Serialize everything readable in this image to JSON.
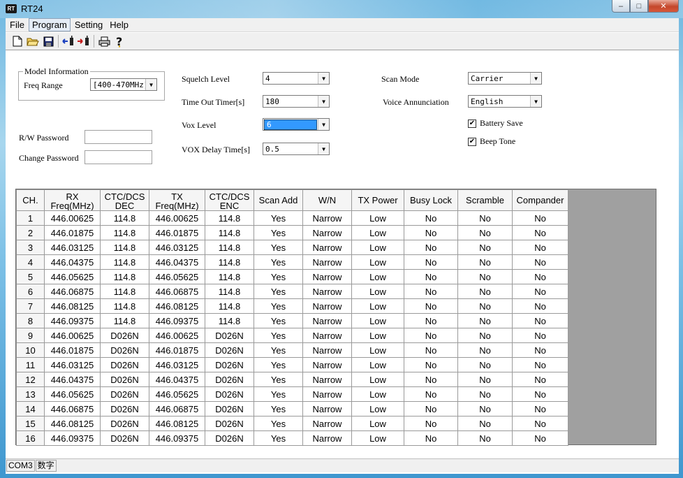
{
  "window": {
    "app_icon_text": "RT",
    "title": "RT24",
    "minimize": "‒",
    "maximize": "□",
    "close": "✕"
  },
  "menu": [
    "File",
    "Program",
    "Setting",
    "Help"
  ],
  "toolbar": [
    "new-file-icon",
    "open-folder-icon",
    "save-icon",
    "read-from-radio-icon",
    "write-to-radio-icon",
    "print-icon",
    "help-icon"
  ],
  "model_info": {
    "group_title": "Model Information",
    "freq_range_label": "Freq Range",
    "freq_range_value": "[400-470MHz]"
  },
  "passwords": {
    "rw_label": "R/W Password",
    "rw_value": "",
    "change_label": "Change Password",
    "change_value": ""
  },
  "settings": {
    "squelch_label": "Squelch Level",
    "squelch_value": "4",
    "tot_label": "Time Out Timer[s]",
    "tot_value": "180",
    "vox_label": "Vox Level",
    "vox_value": "6",
    "vox_delay_label": "VOX Delay Time[s]",
    "vox_delay_value": "0.5",
    "scan_mode_label": "Scan Mode",
    "scan_mode_value": "Carrier",
    "voice_label": "Voice Annunciation",
    "voice_value": "English",
    "battery_save_label": "Battery Save",
    "battery_save_checked": true,
    "beep_tone_label": "Beep Tone",
    "beep_tone_checked": true
  },
  "grid": {
    "headers": [
      [
        "CH.",
        ""
      ],
      [
        "RX",
        "Freq(MHz)"
      ],
      [
        "CTC/DCS",
        "DEC"
      ],
      [
        "TX",
        "Freq(MHz)"
      ],
      [
        "CTC/DCS",
        "ENC"
      ],
      [
        "Scan Add",
        ""
      ],
      [
        "W/N",
        ""
      ],
      [
        "TX Power",
        ""
      ],
      [
        "Busy Lock",
        ""
      ],
      [
        "Scramble",
        ""
      ],
      [
        "Compander",
        ""
      ]
    ],
    "rows": [
      [
        "1",
        "446.00625",
        "114.8",
        "446.00625",
        "114.8",
        "Yes",
        "Narrow",
        "Low",
        "No",
        "No",
        "No"
      ],
      [
        "2",
        "446.01875",
        "114.8",
        "446.01875",
        "114.8",
        "Yes",
        "Narrow",
        "Low",
        "No",
        "No",
        "No"
      ],
      [
        "3",
        "446.03125",
        "114.8",
        "446.03125",
        "114.8",
        "Yes",
        "Narrow",
        "Low",
        "No",
        "No",
        "No"
      ],
      [
        "4",
        "446.04375",
        "114.8",
        "446.04375",
        "114.8",
        "Yes",
        "Narrow",
        "Low",
        "No",
        "No",
        "No"
      ],
      [
        "5",
        "446.05625",
        "114.8",
        "446.05625",
        "114.8",
        "Yes",
        "Narrow",
        "Low",
        "No",
        "No",
        "No"
      ],
      [
        "6",
        "446.06875",
        "114.8",
        "446.06875",
        "114.8",
        "Yes",
        "Narrow",
        "Low",
        "No",
        "No",
        "No"
      ],
      [
        "7",
        "446.08125",
        "114.8",
        "446.08125",
        "114.8",
        "Yes",
        "Narrow",
        "Low",
        "No",
        "No",
        "No"
      ],
      [
        "8",
        "446.09375",
        "114.8",
        "446.09375",
        "114.8",
        "Yes",
        "Narrow",
        "Low",
        "No",
        "No",
        "No"
      ],
      [
        "9",
        "446.00625",
        "D026N",
        "446.00625",
        "D026N",
        "Yes",
        "Narrow",
        "Low",
        "No",
        "No",
        "No"
      ],
      [
        "10",
        "446.01875",
        "D026N",
        "446.01875",
        "D026N",
        "Yes",
        "Narrow",
        "Low",
        "No",
        "No",
        "No"
      ],
      [
        "11",
        "446.03125",
        "D026N",
        "446.03125",
        "D026N",
        "Yes",
        "Narrow",
        "Low",
        "No",
        "No",
        "No"
      ],
      [
        "12",
        "446.04375",
        "D026N",
        "446.04375",
        "D026N",
        "Yes",
        "Narrow",
        "Low",
        "No",
        "No",
        "No"
      ],
      [
        "13",
        "446.05625",
        "D026N",
        "446.05625",
        "D026N",
        "Yes",
        "Narrow",
        "Low",
        "No",
        "No",
        "No"
      ],
      [
        "14",
        "446.06875",
        "D026N",
        "446.06875",
        "D026N",
        "Yes",
        "Narrow",
        "Low",
        "No",
        "No",
        "No"
      ],
      [
        "15",
        "446.08125",
        "D026N",
        "446.08125",
        "D026N",
        "Yes",
        "Narrow",
        "Low",
        "No",
        "No",
        "No"
      ],
      [
        "16",
        "446.09375",
        "D026N",
        "446.09375",
        "D026N",
        "Yes",
        "Narrow",
        "Low",
        "No",
        "No",
        "No"
      ]
    ]
  },
  "status": {
    "port": "COM3",
    "mode": "数字"
  }
}
